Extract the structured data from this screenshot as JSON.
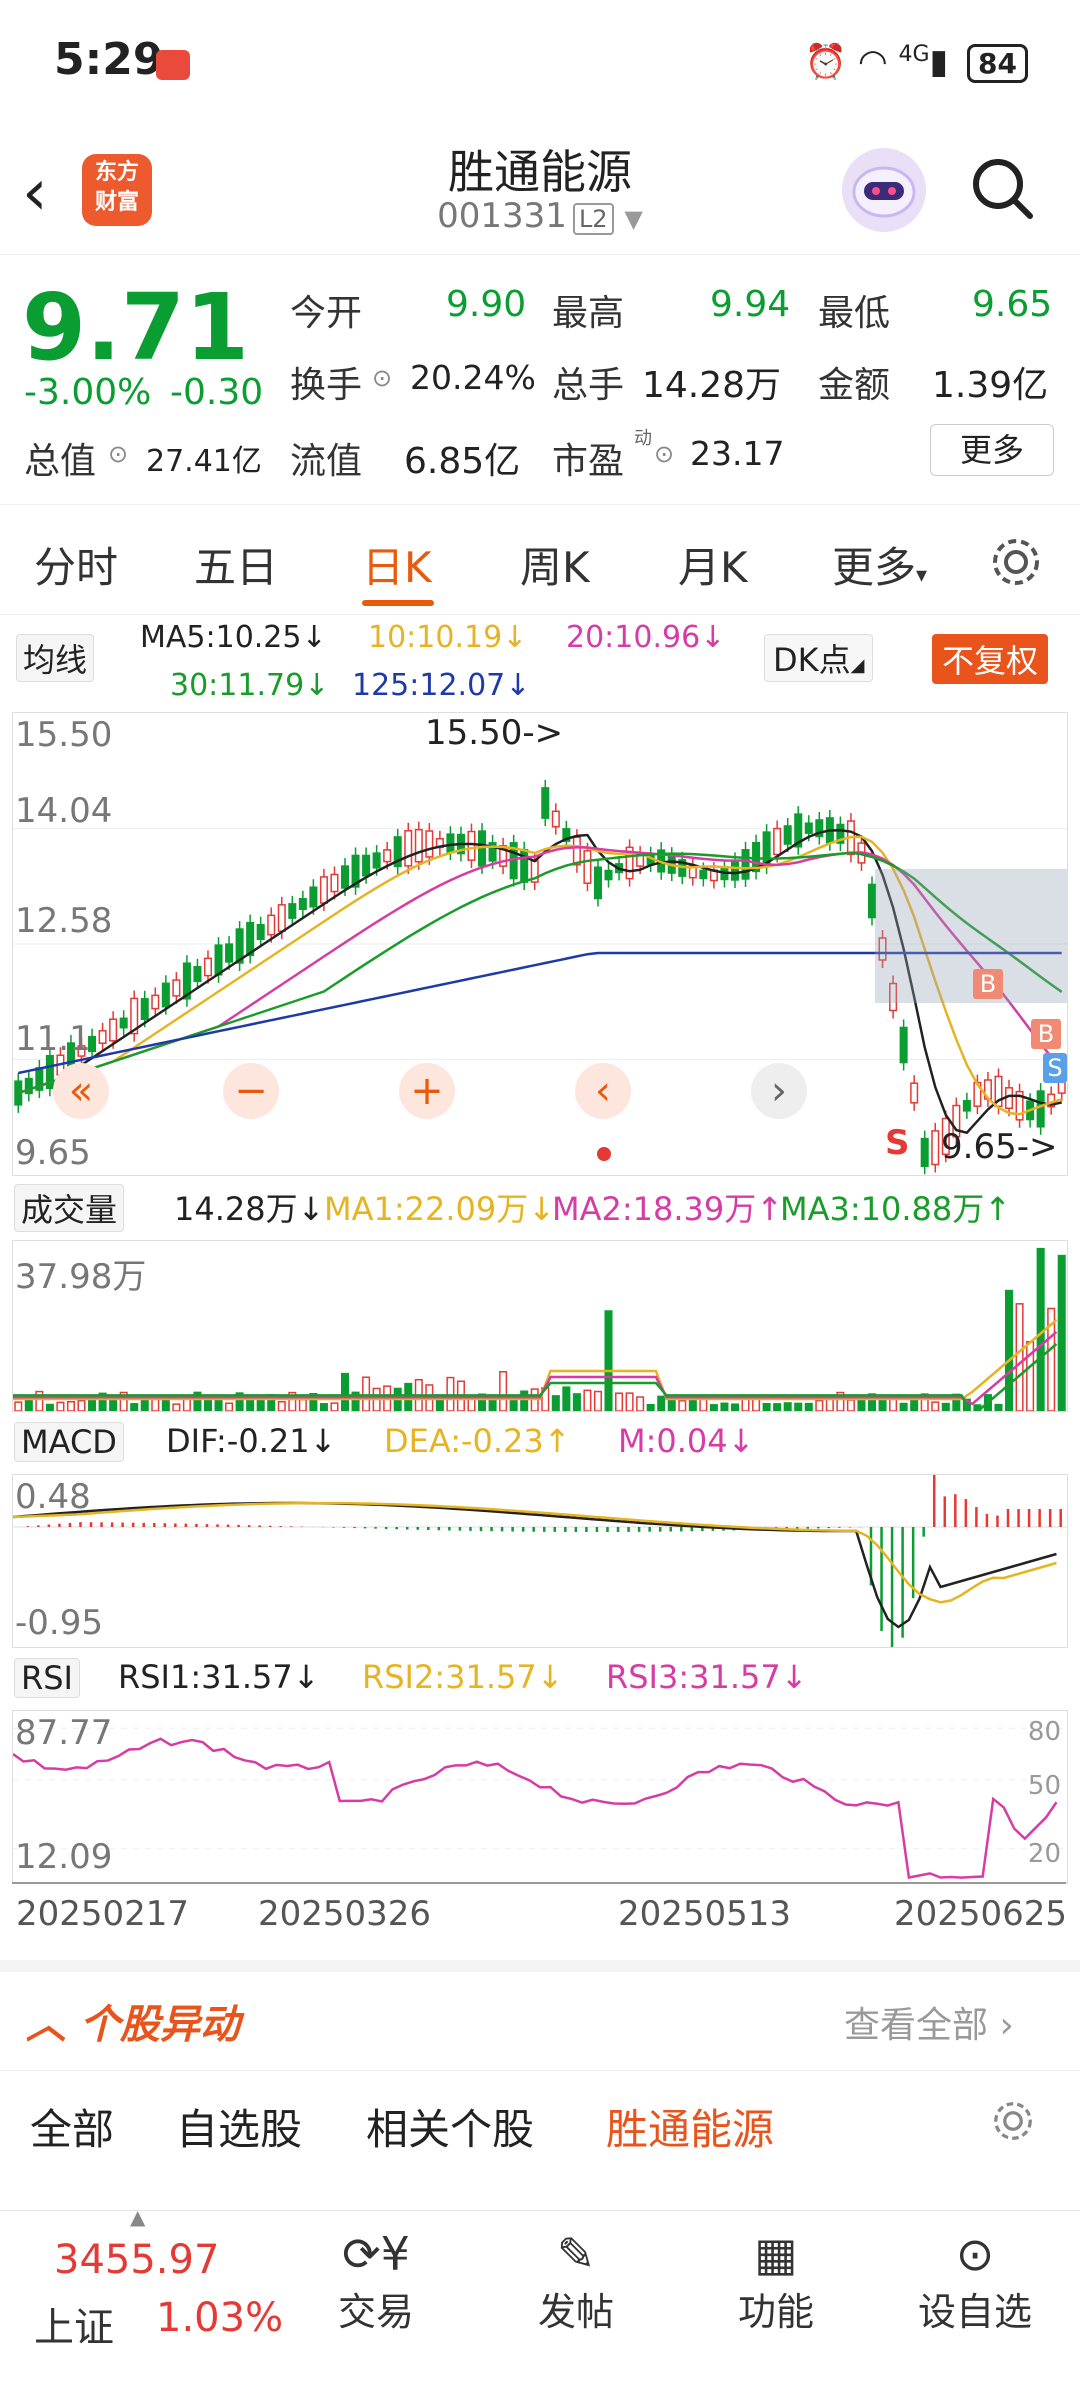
{
  "status_bar": {
    "time": "5:29",
    "network": "4G",
    "battery": "84"
  },
  "header": {
    "logo_line1": "东方",
    "logo_line2": "财富",
    "title": "胜通能源",
    "code": "001331",
    "level": "L2"
  },
  "quote": {
    "price": "9.71",
    "change_pct": "-3.00%",
    "change": "-0.30",
    "open_label": "今开",
    "open": "9.90",
    "high_label": "最高",
    "high": "9.94",
    "low_label": "最低",
    "low": "9.65",
    "turnover_label": "换手",
    "turnover": "20.24%",
    "volume_label": "总手",
    "volume": "14.28万",
    "amount_label": "金额",
    "amount": "1.39亿",
    "mktcap_label": "总值",
    "mktcap": "27.41亿",
    "float_label": "流值",
    "float_cap": "6.85亿",
    "pe_label": "市盈",
    "pe_sup": "动",
    "pe": "23.17",
    "more_label": "更多"
  },
  "tabs": [
    "分时",
    "五日",
    "日K",
    "周K",
    "月K",
    "更多"
  ],
  "active_tab": "日K",
  "ma": {
    "selector": "均线",
    "ma5": "MA5:10.25↓",
    "ma10": "10:10.19↓",
    "ma20": "20:10.96↓",
    "ma30": "30:11.79↓",
    "ma125": "125:12.07↓",
    "dk": "DK点",
    "adjust": "不复权"
  },
  "kline": {
    "y_high": "15.50",
    "y_mid1": "14.04",
    "y_mid2": "12.58",
    "y_mid3": "11.1",
    "y_low": "9.65",
    "peak_label": "15.50->",
    "low_label": "9.65->"
  },
  "volume": {
    "selector": "成交量",
    "value": "14.28万↓",
    "ma1": "MA1:22.09万↓",
    "ma2": "MA2:18.39万↑",
    "ma3": "MA3:10.88万↑",
    "y_max": "37.98万"
  },
  "macd": {
    "selector": "MACD",
    "dif": "DIF:-0.21↓",
    "dea": "DEA:-0.23↑",
    "m": "M:0.04↓",
    "y_max": "0.48",
    "y_min": "-0.95"
  },
  "rsi": {
    "selector": "RSI",
    "rsi1": "RSI1:31.57↓",
    "rsi2": "RSI2:31.57↓",
    "rsi3": "RSI3:31.57↓",
    "y_max": "87.77",
    "y_min": "12.09",
    "r80": "80",
    "r50": "50",
    "r20": "20"
  },
  "dates": [
    "20250217",
    "20250326",
    "20250513",
    "20250625"
  ],
  "alerts": {
    "title": "个股异动",
    "view_all": "查看全部"
  },
  "filter_tabs": [
    "全部",
    "自选股",
    "相关个股",
    "胜通能源"
  ],
  "active_filter": "胜通能源",
  "bottom": {
    "index_value": "3455.97",
    "index_name": "上证",
    "index_change": "1.03%",
    "trade": "交易",
    "post": "发帖",
    "features": "功能",
    "watchlist": "设自选"
  },
  "colors": {
    "up": "#e53935",
    "down": "#0a9d32",
    "accent": "#e85a0c",
    "ma5": "#222222",
    "ma10": "#e6b422",
    "ma20": "#d63ca3",
    "ma30": "#1a9c2b",
    "ma125": "#1f3aa8"
  }
}
